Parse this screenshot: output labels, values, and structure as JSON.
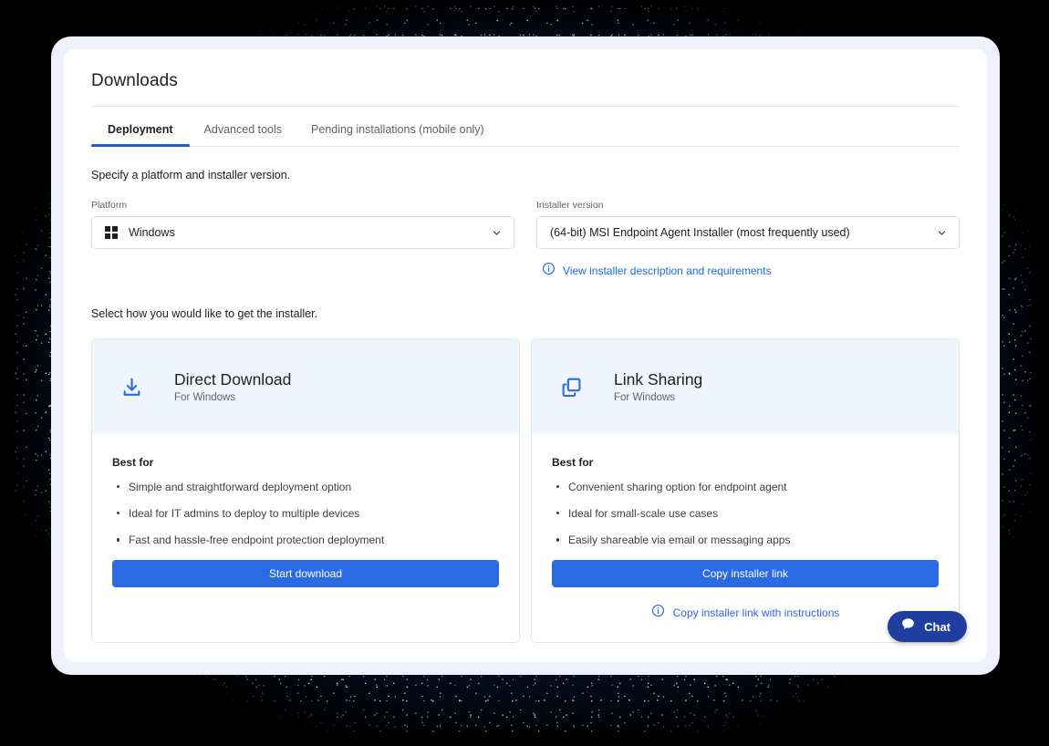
{
  "page": {
    "title": "Downloads"
  },
  "tabs": [
    {
      "label": "Deployment",
      "active": true
    },
    {
      "label": "Advanced tools",
      "active": false
    },
    {
      "label": "Pending installations (mobile only)",
      "active": false
    }
  ],
  "instructions": {
    "specify": "Specify a platform and installer version.",
    "select_method": "Select how you would like to get the installer."
  },
  "selectors": {
    "platform": {
      "label": "Platform",
      "value": "Windows",
      "icon": "windows-logo-icon"
    },
    "installer_version": {
      "label": "Installer version",
      "value": "(64-bit) MSI Endpoint Agent Installer (most frequently used)"
    },
    "info_link": {
      "label": "View installer description and requirements",
      "icon": "info-circle-icon"
    }
  },
  "options": [
    {
      "icon": "download-icon",
      "title": "Direct Download",
      "subtitle": "For Windows",
      "best_for_label": "Best for",
      "bullets": [
        "Simple and straightforward deployment option",
        "Ideal for IT admins to deploy to multiple devices",
        "Fast and hassle-free endpoint protection deployment"
      ],
      "button": "Start download",
      "secondary": null
    },
    {
      "icon": "copy-icon",
      "title": "Link Sharing",
      "subtitle": "For Windows",
      "best_for_label": "Best for",
      "bullets": [
        "Convenient sharing option for endpoint agent",
        "Ideal for small-scale use cases",
        "Easily shareable via email or messaging apps"
      ],
      "button": "Copy installer link",
      "secondary": "Copy installer link with instructions"
    }
  ],
  "chat": {
    "label": "Chat",
    "icon": "chat-bubble-icon"
  },
  "colors": {
    "accent_blue": "#2b6ae3",
    "link_blue": "#1a6ae8",
    "tab_underline": "#1a5ce0",
    "card_header_bg": "#f0f4fd",
    "chat_blue": "#1f3fa0",
    "frame_bg": "#eef1fb"
  }
}
